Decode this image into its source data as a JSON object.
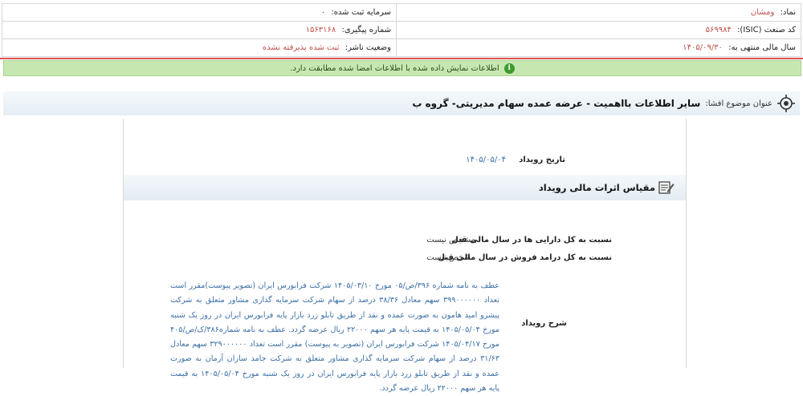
{
  "company_info": {
    "symbol_label": "نماد:",
    "symbol_value": "ومشان",
    "capital_label": "سرمایه ثبت شده:",
    "capital_value": "۰",
    "isic_label": "کد صنعت (ISIC):",
    "isic_value": "۵۶۹۹۸۴",
    "tracking_label": "شماره پیگیری:",
    "tracking_value": "۱۵۶۳۱۶۸",
    "fiscal_label": "سال مالی منتهی به:",
    "fiscal_value": "۱۴۰۵/۰۹/۳۰",
    "publisher_label": "وضعیت ناشر:",
    "publisher_value": "ثبت شده پذیرفته نشده"
  },
  "notice": {
    "text": "اطلاعات نمایش داده شده با اطلاعات امضا شده مطابقت دارد."
  },
  "subject": {
    "label": "عنوان موضوع افشا:",
    "title": "سایر اطلاعات بااهمیت - عرضه عمده سهام مدیریتی- گروه ب"
  },
  "event": {
    "date_label": "تاریخ رویداد",
    "date_value": "۱۴۰۵/۰۵/۰۴"
  },
  "financial_effects": {
    "title": "مقیاس اثرات مالی رویداد",
    "rows": [
      {
        "label": "نسبت به کل دارایی ها در سال مالی قبل",
        "value": "مشخص نیست"
      },
      {
        "label": "نسبت به کل درامد فروش در سال مالی قبل",
        "value": "مشخص نیست"
      }
    ]
  },
  "description": {
    "label": "شرح رویداد",
    "text": "عطف به نامه شماره ۳۹۶/ص/۰۵ مورخ ۱۴۰۵/۰۳/۱۰ شرکت فرابورس ایران (تصویر پیوست)مقرر است تعداد ۳۹۹۰۰۰۰۰۰ سهم معادل ۳۸/۳۶ درصد از سهام شرکت سرمایه گذاری مشاور متعلق به شرکت پیشرو امید هامون به صورت عمده و نقد از طریق تابلو زرد بازار پایه فرابورس ایران در روز یک شنبه مورخ ۱۴۰۵/۰۵/۰۴ به قیمت پایه هر سهم ۲۲۰۰۰ ریال عرضه گردد. عطف به نامه شماره۳۸۶/ک/ص/۴۰۵ مورخ ۱۴۰۵/۰۴/۱۷ شرکت فرابورس ایران (تصویر به پیوست) مقرر است تعداد ۳۲۹۰۰۰۰۰۰ سهم معادل ۳۱/۶۳ درصد از سهام شرکت سرمایه گذاری مشاور متعلق به شرکت جامد سازان آرمان به صورت عمده و نقد از طریق تابلو زرد بازار پایه فرابورس ایران در روز یک شنبه مورخ ۱۴۰۵/۰۵/۰۴ به قیمت پایه هر سهم ۲۲۰۰۰ ریال عرضه گردد."
  },
  "colors": {
    "accent_red": "#d9534f",
    "notice_green": "#c6e8b0",
    "link_blue": "#3a6ea5"
  }
}
